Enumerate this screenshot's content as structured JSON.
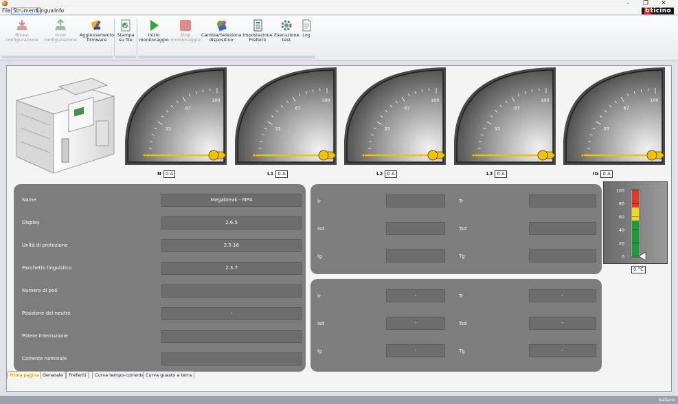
{
  "window": {
    "minimize": "–",
    "maximize": "❐",
    "close": "✕"
  },
  "menu": [
    "File",
    "Strumenti",
    "Lingua",
    "Info"
  ],
  "brand": {
    "b": "b",
    "rest": "ticino"
  },
  "toolbar": {
    "receive_config": "Ricevi\nconfigurazione",
    "send_config": "Invio\nconfigurazione",
    "update_firmware": "Aggiornamento\nfirmware",
    "print_file": "Stampa\nsu file",
    "start_monitor": "Inizio\nmonitoraggio",
    "stop_monitor": "Stop\nmonitoraggio",
    "change_device": "Cambia/Seleziona\ndispositivo",
    "favorites": "Impostazione\nPreferiti",
    "run_test": "Esecuzione\ntest",
    "log": "Log"
  },
  "gauges": [
    {
      "name": "N",
      "value": "0 A",
      "ticks": [
        "33",
        "67",
        "100"
      ],
      "level": 0
    },
    {
      "name": "L1",
      "value": "0 A",
      "ticks": [
        "33",
        "67",
        "100"
      ],
      "level": 0
    },
    {
      "name": "L2",
      "value": "0 A",
      "ticks": [
        "33",
        "67",
        "100"
      ],
      "level": 0
    },
    {
      "name": "L3",
      "value": "0 A",
      "ticks": [
        "33",
        "67",
        "100"
      ],
      "level": 0
    },
    {
      "name": "IG",
      "value": "0 A",
      "ticks": [
        "33",
        "67",
        "100"
      ],
      "level": 0
    }
  ],
  "device_info": [
    {
      "label": "Name",
      "value": "Megabreak - MP4"
    },
    {
      "label": "Display",
      "value": "2.6.5"
    },
    {
      "label": "Unità di protezione",
      "value": "2.5.16"
    },
    {
      "label": "Pacchetto linguistico",
      "value": "2.3.7"
    },
    {
      "label": "Numero di poli",
      "value": ""
    },
    {
      "label": "Posizione del neutro",
      "value": "-"
    },
    {
      "label": "Potere Interruzione",
      "value": ""
    },
    {
      "label": "Corrente nominale",
      "value": ""
    }
  ],
  "protection_top": [
    {
      "l1": "Ir",
      "v1": "",
      "l2": "Tr",
      "v2": ""
    },
    {
      "l1": "Isd",
      "v1": "",
      "l2": "Tsd",
      "v2": ""
    },
    {
      "l1": "Ig",
      "v1": "",
      "l2": "Tg",
      "v2": ""
    }
  ],
  "protection_bottom": [
    {
      "l1": "Ir",
      "v1": "-",
      "l2": "Tr",
      "v2": "-"
    },
    {
      "l1": "Isd",
      "v1": "-",
      "l2": "Tsd",
      "v2": "-"
    },
    {
      "l1": "Ig",
      "v1": "-",
      "l2": "Tg",
      "v2": "-"
    }
  ],
  "thermometer": {
    "scale": [
      "100",
      "80",
      "60",
      "40",
      "20",
      "0"
    ],
    "value": "0 °C",
    "level": 0,
    "colors": {
      "red": "#e23a2a",
      "yellow": "#f2d624",
      "green": "#1f9a3a"
    }
  },
  "tabs": [
    "Prima pagina",
    "Generale",
    "Preferiti",
    "Curva tempo-corrente",
    "Curva guasto a terra"
  ],
  "status": {
    "language": "Italiano"
  },
  "colors": {
    "gauge_needle": "#f2c200",
    "panel": "#7d7d7d",
    "active_tab": "#d07800"
  }
}
